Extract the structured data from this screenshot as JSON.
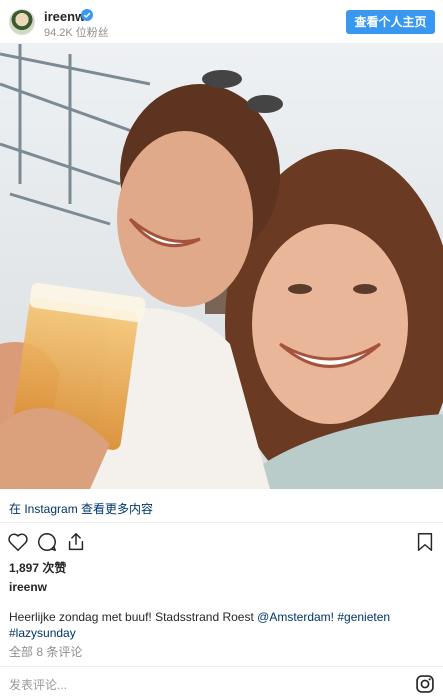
{
  "header": {
    "username": "ireenw",
    "followers": "94.2K 位粉丝",
    "profile_button": "查看个人主页"
  },
  "photo": {
    "alt": "Two smiling women taking a selfie, one holding a glass of beer"
  },
  "view_more": "在 Instagram 查看更多内容",
  "actions": {
    "like_icon": "heart-icon",
    "comment_icon": "comment-icon",
    "share_icon": "share-icon",
    "save_icon": "bookmark-icon"
  },
  "likes": "1,897 次赞",
  "author": "ireenw",
  "caption": {
    "text_before": "Heerlijke zondag met buuf! Stadsstrand Roest ",
    "mention": "@Amsterdam!",
    "hashtag1": "#genieten",
    "hashtag2": "#lazysunday"
  },
  "comments_link": "全部 8 条评论",
  "comment_placeholder": "发表评论...",
  "colors": {
    "accent": "#3897f0",
    "link": "#003569",
    "muted": "#8e8e8e",
    "text": "#262626"
  }
}
